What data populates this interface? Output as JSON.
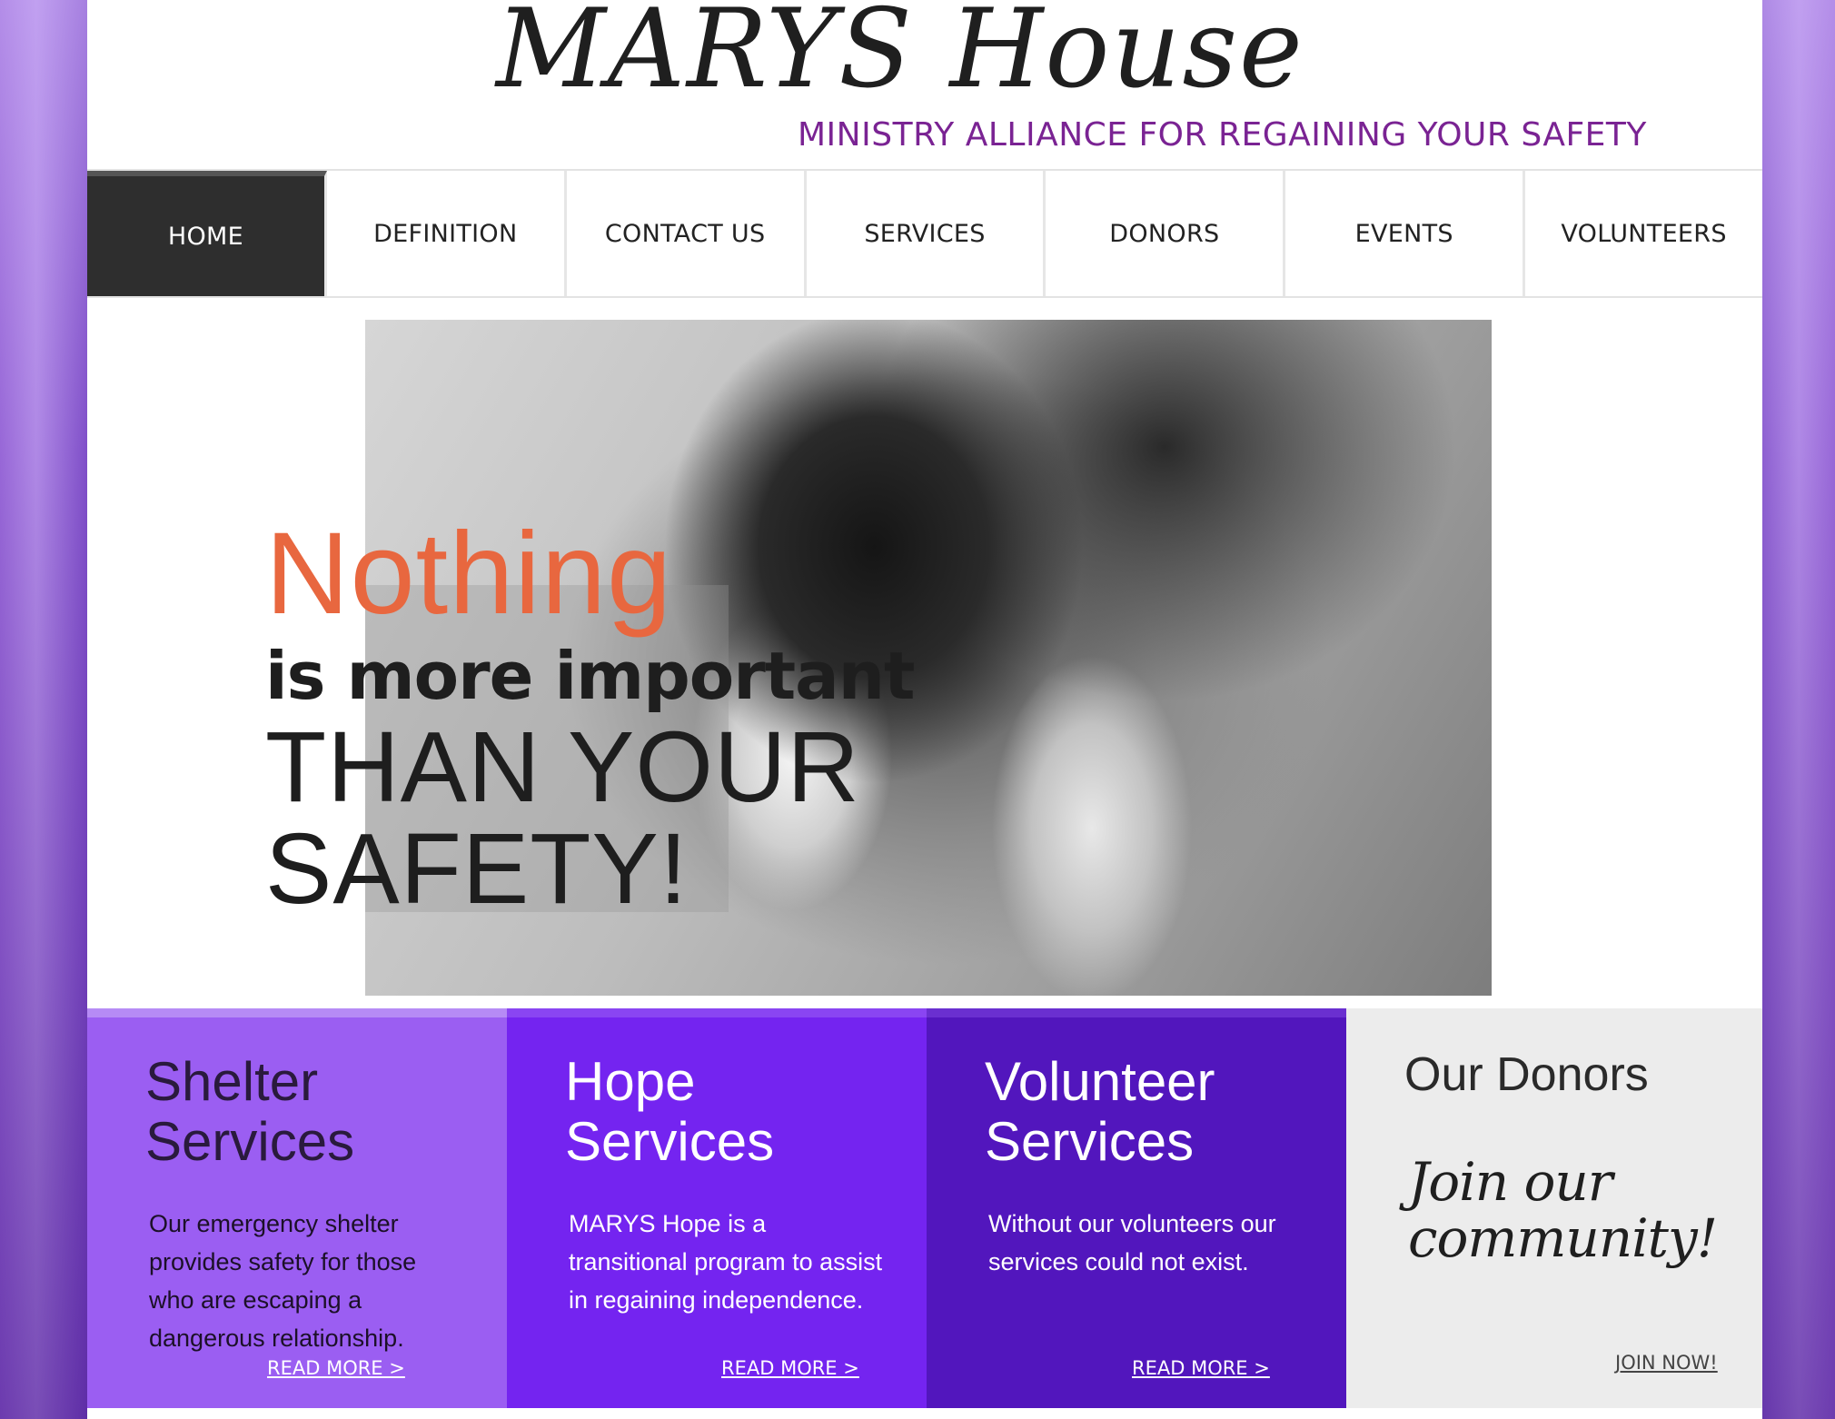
{
  "header": {
    "logo_text": "MARYS House",
    "tagline": "MINISTRY ALLIANCE FOR REGAINING YOUR SAFETY"
  },
  "nav": {
    "items": [
      {
        "label": "HOME",
        "active": true
      },
      {
        "label": "DEFINITION"
      },
      {
        "label": "CONTACT US"
      },
      {
        "label": "SERVICES"
      },
      {
        "label": "DONORS"
      },
      {
        "label": "EVENTS"
      },
      {
        "label": "VOLUNTEERS"
      }
    ]
  },
  "hero": {
    "line1": "Nothing",
    "line2": "is more important",
    "line3": "THAN YOUR",
    "line4": "SAFETY!"
  },
  "features": {
    "shelter": {
      "title": "Shelter Services",
      "description": "Our emergency shelter provides safety for those who are escaping a dangerous relationship.",
      "link": "READ MORE >"
    },
    "hope": {
      "title": "Hope Services",
      "description": "MARYS Hope is a transitional program to assist in regaining independence.",
      "link": "READ MORE >"
    },
    "volunteer": {
      "title": "Volunteer Services",
      "description": "Without our volunteers our services could not exist.",
      "link": "READ MORE >"
    },
    "donors": {
      "title": "Our Donors",
      "script_text": "Join our community!",
      "link": "JOIN NOW!"
    }
  },
  "colors": {
    "tagline": "#7a2393",
    "hero_accent": "#e8673f",
    "shelter_bg": "#9b5ef2",
    "hope_bg": "#7424f0",
    "volunteer_bg": "#5216bd",
    "donors_bg": "#ececec",
    "nav_active_bg": "#2e2e2e"
  }
}
